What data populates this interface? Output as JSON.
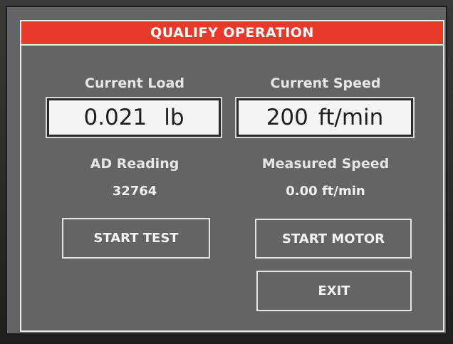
{
  "title": "QUALIFY OPERATION",
  "load": {
    "label": "Current Load",
    "value": "0.021",
    "unit": "lb"
  },
  "speed": {
    "label": "Current Speed",
    "value": "200",
    "unit": "ft/min"
  },
  "ad": {
    "label": "AD Reading",
    "value": "32764"
  },
  "measured": {
    "label": "Measured Speed",
    "value": "0.00 ft/min"
  },
  "buttons": {
    "start_test": "START TEST",
    "start_motor": "START MOTOR",
    "exit": "EXIT"
  },
  "colors": {
    "title_bar": "#e8392a",
    "screen_bg": "#636466",
    "value_box_bg": "#f4f4f2"
  }
}
